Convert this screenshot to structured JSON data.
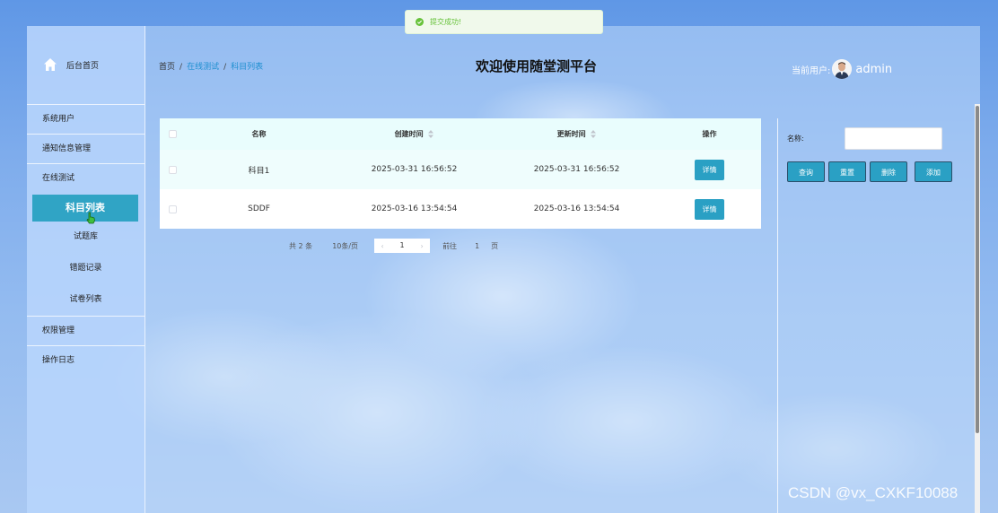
{
  "toast": {
    "message": "提交成功!"
  },
  "brand": {
    "label": "后台首页"
  },
  "sidebar": {
    "items": [
      {
        "label": "系统用户"
      },
      {
        "label": "通知信息管理"
      },
      {
        "label": "在线测试"
      },
      {
        "label": "权限管理"
      },
      {
        "label": "操作日志"
      }
    ],
    "submenu": [
      {
        "label": "科目列表",
        "active": true
      },
      {
        "label": "试题库"
      },
      {
        "label": "错题记录"
      },
      {
        "label": "试卷列表"
      }
    ]
  },
  "breadcrumb": {
    "home": "首页",
    "sep": "/",
    "level1": "在线测试",
    "level2": "科目列表"
  },
  "header": {
    "title": "欢迎使用随堂测平台",
    "user_label": "当前用户:",
    "user_name": "admin"
  },
  "table": {
    "columns": {
      "name": "名称",
      "created": "创建时间",
      "updated": "更新时间",
      "op": "操作"
    },
    "rows": [
      {
        "name": "科目1",
        "created": "2025-03-31 16:56:52",
        "updated": "2025-03-31 16:56:52",
        "action": "详情"
      },
      {
        "name": "SDDF",
        "created": "2025-03-16 13:54:54",
        "updated": "2025-03-16 13:54:54",
        "action": "详情"
      }
    ]
  },
  "pager": {
    "total": "共 2 条",
    "size": "10条/页",
    "prev": "‹",
    "page": "1",
    "next": "›",
    "goto": "前往",
    "goto_num": "1",
    "unit": "页"
  },
  "search": {
    "label": "名称:",
    "value": ""
  },
  "actions": {
    "query": "查询",
    "reset": "重置",
    "delete": "删除",
    "add": "添加"
  },
  "watermark": "CSDN @vx_CXKF10088",
  "colors": {
    "accent": "#2aa0c4",
    "active_menu": "#30a4c5",
    "success": "#67c23a"
  }
}
